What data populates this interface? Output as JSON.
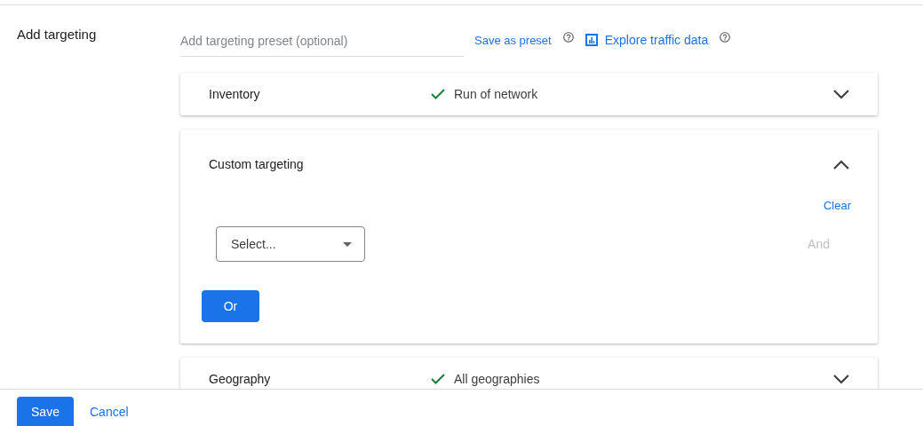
{
  "section_label": "Add targeting",
  "preset_field": {
    "placeholder": "Add targeting preset (optional)"
  },
  "save_preset_link": "Save as preset",
  "explore_link": "Explore traffic data",
  "panels": [
    {
      "title": "Inventory",
      "summary": "Run of network",
      "expanded": false
    },
    {
      "title": "Custom targeting",
      "expanded": true,
      "clear_link": "Clear",
      "select": {
        "placeholder": "Select..."
      },
      "and_button": {
        "label": "And",
        "disabled": true
      },
      "or_button": "Or"
    },
    {
      "title": "Geography",
      "summary": "All geographies",
      "expanded": false
    }
  ],
  "footer_buttons": [
    {
      "label": "Save",
      "kind": "primary"
    },
    {
      "label": "Cancel",
      "kind": "text"
    }
  ]
}
